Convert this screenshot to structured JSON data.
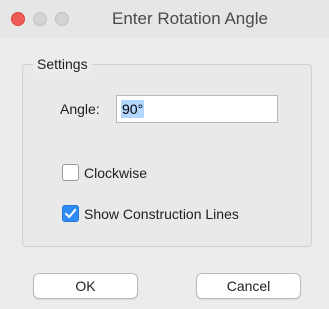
{
  "window": {
    "title": "Enter Rotation Angle"
  },
  "settings": {
    "group_label": "Settings",
    "angle_label": "Angle:",
    "angle_value": "90°",
    "clockwise": {
      "label": "Clockwise",
      "checked": false
    },
    "show_construction_lines": {
      "label": "Show Construction Lines",
      "checked": true
    }
  },
  "buttons": {
    "ok_label": "OK",
    "cancel_label": "Cancel"
  },
  "colors": {
    "close_button": "#ee5c55",
    "checkbox_accent": "#2f8cf5",
    "selection_highlight": "#b3d7ff"
  },
  "icons": {
    "close": "close-icon",
    "minimize": "minimize-icon",
    "maximize": "maximize-icon",
    "checkmark": "checkmark-icon"
  }
}
